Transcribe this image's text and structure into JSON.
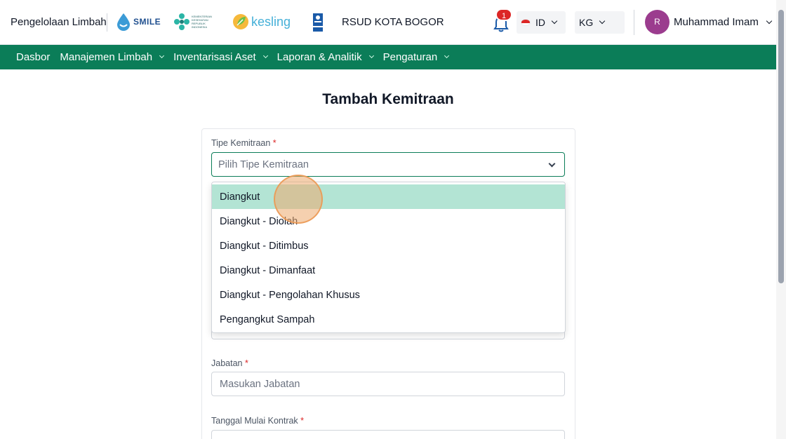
{
  "header": {
    "brand": "Pengelolaan Limbah",
    "logos": {
      "smile": "SMILE",
      "kemenkes": "KEMENTERIAN KESEHATAN REPUBLIK INDONESIA",
      "kesling": "kesling",
      "undp_icon": "undp-logo-icon"
    },
    "org_name": "RSUD KOTA BOGOR",
    "notification_count": "1",
    "language": "ID",
    "unit": "KG",
    "user": {
      "initial": "R",
      "name": "Muhammad Imam"
    }
  },
  "nav": {
    "items": [
      {
        "label": "Dasbor",
        "dropdown": false
      },
      {
        "label": "Manajemen Limbah",
        "dropdown": true
      },
      {
        "label": "Inventarisasi Aset",
        "dropdown": true
      },
      {
        "label": "Laporan & Analitik",
        "dropdown": true
      },
      {
        "label": "Pengaturan",
        "dropdown": true
      }
    ]
  },
  "form": {
    "title": "Tambah Kemitraan",
    "tipe": {
      "label": "Tipe Kemitraan",
      "required": "*",
      "placeholder": "Pilih Tipe Kemitraan"
    },
    "options": [
      "Diangkut",
      "Diangkut - Diolah",
      "Diangkut - Ditimbus",
      "Diangkut - Dimanfaat",
      "Diangkut - Pengolahan Khusus",
      "Pengangkut Sampah"
    ],
    "active_option": 0,
    "jabatan": {
      "label": "Jabatan",
      "required": "*",
      "placeholder": "Masukan Jabatan"
    },
    "tanggal": {
      "label": "Tanggal Mulai Kontrak",
      "required": "*"
    }
  },
  "colors": {
    "primary": "#0b7d58",
    "highlight": "#b3e4d4",
    "badge": "#dc2626",
    "avatar": "#9b3c8e"
  }
}
